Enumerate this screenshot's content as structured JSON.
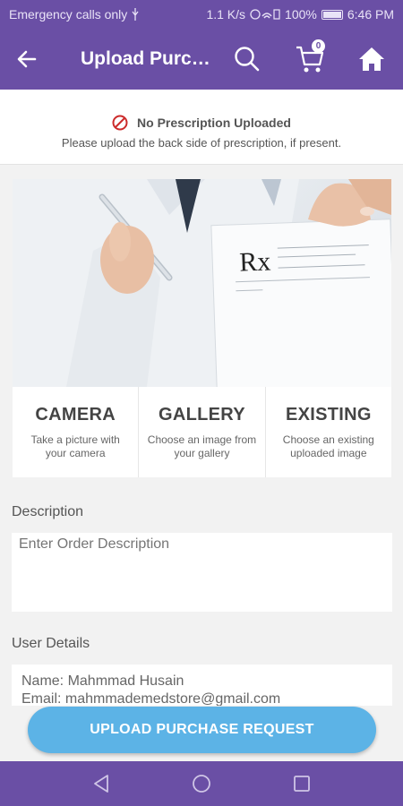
{
  "status_bar": {
    "carrier": "Emergency calls only",
    "speed": "1.1 K/s",
    "battery": "100%",
    "time": "6:46 PM"
  },
  "app_bar": {
    "title": "Upload Purch...",
    "cart_count": "0",
    "color": "#6a4fa5"
  },
  "notice": {
    "title": "No Prescription Uploaded",
    "subtitle": "Please upload the back side of prescription, if present."
  },
  "options": [
    {
      "title": "CAMERA",
      "desc": "Take a picture with your camera"
    },
    {
      "title": "GALLERY",
      "desc": "Choose an image from your gallery"
    },
    {
      "title": "EXISTING",
      "desc": "Choose an existing uploaded image"
    }
  ],
  "form": {
    "description_label": "Description",
    "description_placeholder": "Enter Order Description",
    "user_details_label": "User Details",
    "user_name": "Name: Mahmmad Husain",
    "user_email": "Email: mahmmademedstore@gmail.com"
  },
  "upload_button": {
    "label": "UPLOAD PURCHASE REQUEST",
    "color": "#5cb3e6"
  },
  "hero_image": {
    "rx_symbol": "Rx"
  }
}
